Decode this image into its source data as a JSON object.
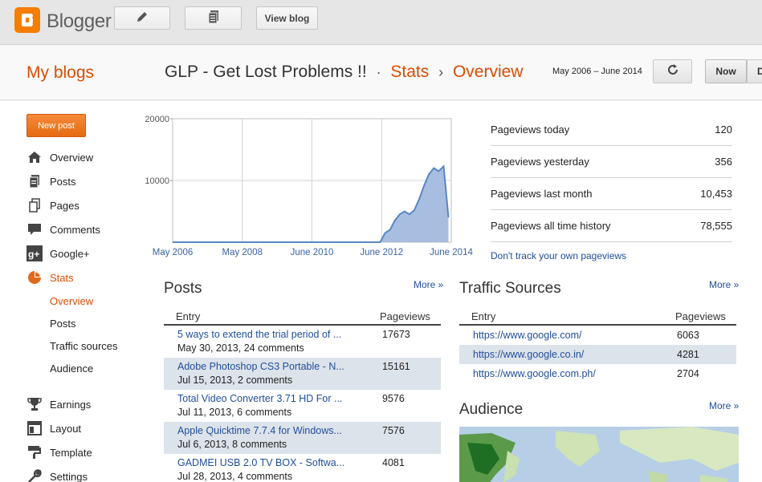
{
  "app": {
    "name": "Blogger"
  },
  "toolbar": {
    "view_blog": "View blog"
  },
  "header": {
    "my_blogs": "My blogs",
    "blog_name": "GLP - Get Lost Problems !!",
    "dot": "·",
    "crumb_stats": "Stats",
    "arrow": "›",
    "crumb_overview": "Overview",
    "date_range": "May 2006 – June 2014",
    "now_label": "Now",
    "d_label": "D"
  },
  "sidebar": {
    "new_post": "New post",
    "items": [
      {
        "label": "Overview",
        "icon": "home-icon"
      },
      {
        "label": "Posts",
        "icon": "posts-icon"
      },
      {
        "label": "Pages",
        "icon": "pages-icon"
      },
      {
        "label": "Comments",
        "icon": "comments-icon"
      },
      {
        "label": "Google+",
        "icon": "google-plus-icon"
      },
      {
        "label": "Stats",
        "icon": "stats-icon"
      },
      {
        "label": "Earnings",
        "icon": "trophy-icon"
      },
      {
        "label": "Layout",
        "icon": "layout-icon"
      },
      {
        "label": "Template",
        "icon": "template-icon"
      },
      {
        "label": "Settings",
        "icon": "wrench-icon"
      }
    ],
    "stats_sub": [
      "Overview",
      "Posts",
      "Traffic sources",
      "Audience"
    ]
  },
  "chart_data": {
    "type": "area",
    "y_ticks": [
      "20000",
      "10000"
    ],
    "x_ticks": [
      "May 2006",
      "May 2008",
      "June 2010",
      "June 2012",
      "June 2014"
    ],
    "ylim": [
      0,
      20000
    ],
    "x": [
      "2006-05",
      "2007-05",
      "2008-05",
      "2009-05",
      "2010-06",
      "2011-06",
      "2012-04",
      "2012-06",
      "2012-08",
      "2012-10",
      "2012-12",
      "2013-02",
      "2013-04",
      "2013-06",
      "2013-08",
      "2013-10",
      "2013-12",
      "2014-02",
      "2014-04",
      "2014-06"
    ],
    "values": [
      0,
      0,
      0,
      0,
      0,
      0,
      0,
      0,
      1500,
      2000,
      3500,
      4500,
      5000,
      4500,
      5200,
      7000,
      9200,
      11000,
      12000,
      11500,
      12300,
      4000
    ],
    "color": "#5a86c4"
  },
  "stats": [
    {
      "label": "Pageviews today",
      "value": "120"
    },
    {
      "label": "Pageviews yesterday",
      "value": "356"
    },
    {
      "label": "Pageviews last month",
      "value": "10,453"
    },
    {
      "label": "Pageviews all time history",
      "value": "78,555"
    }
  ],
  "dont_track": "Don't track your own pageviews",
  "posts": {
    "title": "Posts",
    "more": "More »",
    "col_entry": "Entry",
    "col_pageviews": "Pageviews",
    "rows": [
      {
        "title": "5 ways to extend the trial period of ...",
        "meta": "May 30, 2013, 24 comments",
        "pv": "17673"
      },
      {
        "title": "Adobe Photoshop CS3 Portable - N...",
        "meta": "Jul 15, 2013, 2 comments",
        "pv": "15161"
      },
      {
        "title": "Total Video Converter 3.71 HD For ...",
        "meta": "Jul 11, 2013, 6 comments",
        "pv": "9576"
      },
      {
        "title": "Apple Quicktime 7.7.4 for Windows...",
        "meta": "Jul 6, 2013, 8 comments",
        "pv": "7576"
      },
      {
        "title": "GADMEI USB 2.0 TV BOX - Softwa...",
        "meta": "Jul 28, 2013, 4 comments",
        "pv": "4081"
      }
    ]
  },
  "traffic": {
    "title": "Traffic Sources",
    "more": "More »",
    "col_entry": "Entry",
    "col_pageviews": "Pageviews",
    "rows": [
      {
        "url": "https://www.google.com/",
        "pv": "6063"
      },
      {
        "url": "https://www.google.co.in/",
        "pv": "4281"
      },
      {
        "url": "https://www.google.com.ph/",
        "pv": "2704"
      }
    ]
  },
  "audience": {
    "title": "Audience",
    "more": "More »"
  }
}
